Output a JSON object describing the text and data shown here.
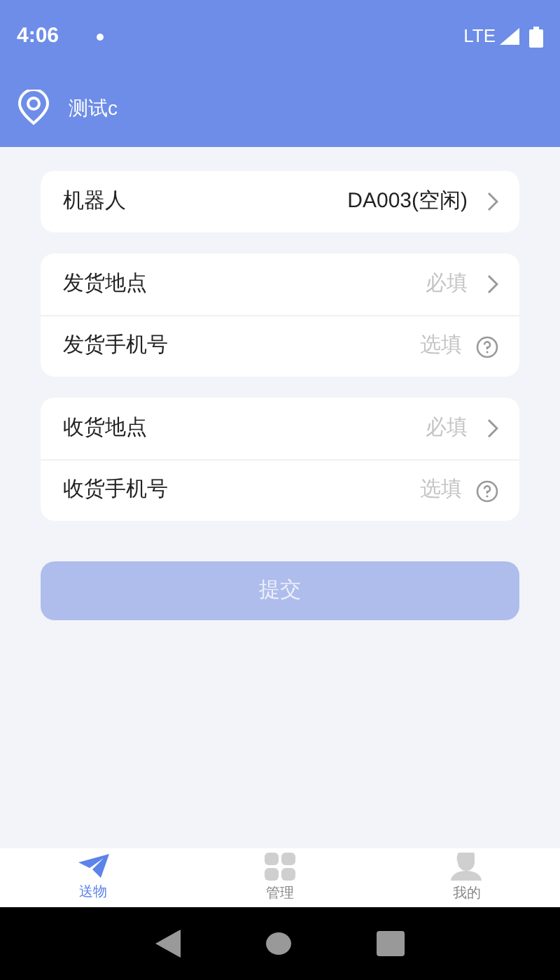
{
  "status_bar": {
    "time": "4:06",
    "network": "LTE"
  },
  "header": {
    "location": "测试c"
  },
  "groups": [
    {
      "rows": [
        {
          "label": "机器人",
          "value": "DA003(空闲)",
          "kind": "select"
        }
      ]
    },
    {
      "rows": [
        {
          "label": "发货地点",
          "placeholder": "必填",
          "kind": "select"
        },
        {
          "label": "发货手机号",
          "placeholder": "选填",
          "kind": "phone"
        }
      ]
    },
    {
      "rows": [
        {
          "label": "收货地点",
          "placeholder": "必填",
          "kind": "select"
        },
        {
          "label": "收货手机号",
          "placeholder": "选填",
          "kind": "phone"
        }
      ]
    }
  ],
  "submit": {
    "label": "提交",
    "disabled": true
  },
  "tabs": [
    {
      "label": "送物",
      "kind": "send",
      "selected": true
    },
    {
      "label": "管理",
      "kind": "manage",
      "selected": false
    },
    {
      "label": "我的",
      "kind": "me",
      "selected": false
    }
  ]
}
